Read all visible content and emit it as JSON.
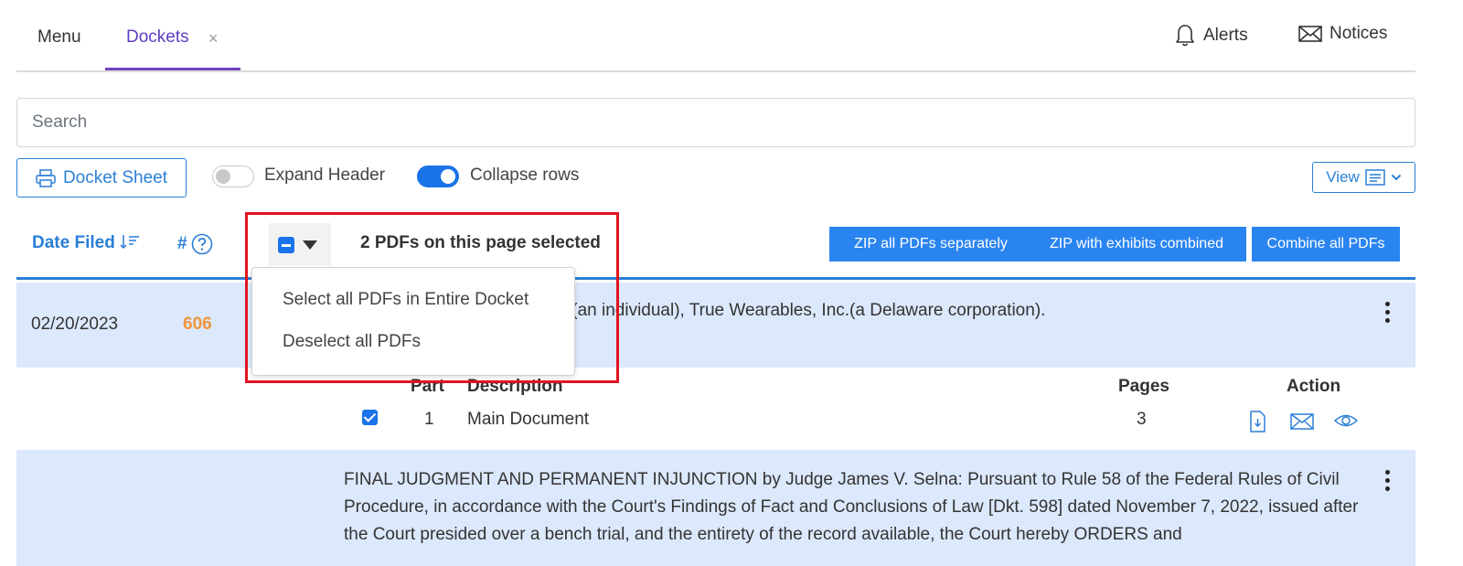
{
  "nav": {
    "tabs": [
      {
        "label": "Menu"
      },
      {
        "label": "Dockets",
        "close": "×"
      }
    ],
    "alerts_label": "Alerts",
    "notices_label": "Notices"
  },
  "search": {
    "placeholder": "Search"
  },
  "toolbar": {
    "docket_sheet_label": "Docket Sheet",
    "expand_header_label": "Expand Header",
    "expand_header_on": false,
    "collapse_rows_label": "Collapse rows",
    "collapse_rows_on": true,
    "view_label": "View"
  },
  "table_header": {
    "date_filed": "Date Filed",
    "number": "#",
    "selection_summary": "2 PDFs on this page selected",
    "zip_separately": "ZIP all PDFs separately",
    "zip_combined": "ZIP with exhibits combined",
    "combine_all": "Combine all PDFs"
  },
  "dropdown": {
    "items": [
      "Select all PDFs in Entire Docket",
      "Deselect all PDFs"
    ]
  },
  "rows": [
    {
      "date": "02/20/2023",
      "number": "606",
      "description_visible": "y Defendant Marcelo Lamego(an individual), True Wearables, Inc.(a Delaware corporation).",
      "documents": {
        "headers": {
          "part": "Part",
          "description": "Description",
          "pages": "Pages",
          "action": "Action"
        },
        "items": [
          {
            "checked": true,
            "part": "1",
            "description": "Main Document",
            "pages": "3"
          }
        ]
      }
    },
    {
      "description": "FINAL JUDGMENT AND PERMANENT INJUNCTION by Judge James V. Selna: Pursuant to Rule 58 of the Federal Rules of Civil Procedure, in accordance with the Court's Findings of Fact and Conclusions of Law [Dkt. 598] dated November 7, 2022, issued after the Court presided over a bench trial, and the entirety of the record available, the Court hereby ORDERS and"
    }
  ],
  "colors": {
    "accent": "#2a7fd6",
    "tab_active": "#5f3dc4",
    "row_highlight": "#dce8fb",
    "entry_number": "#f0953a",
    "highlight_box": "#e0141e"
  }
}
